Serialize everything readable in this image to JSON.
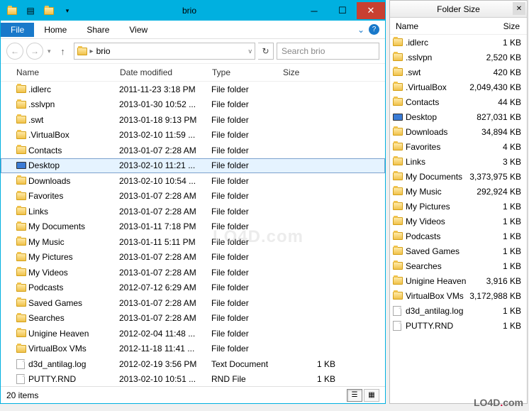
{
  "window": {
    "title": "brio",
    "tabs": {
      "file": "File",
      "home": "Home",
      "share": "Share",
      "view": "View"
    },
    "breadcrumb": "brio",
    "search_placeholder": "Search brio",
    "columns": {
      "name": "Name",
      "date": "Date modified",
      "type": "Type",
      "size": "Size"
    },
    "status": "20 items",
    "selected_index": 5
  },
  "files": [
    {
      "name": ".idlerc",
      "date": "2011-11-23 3:18 PM",
      "type": "File folder",
      "size": "",
      "icon": "folder"
    },
    {
      "name": ".sslvpn",
      "date": "2013-01-30 10:52 ...",
      "type": "File folder",
      "size": "",
      "icon": "folder"
    },
    {
      "name": ".swt",
      "date": "2013-01-18 9:13 PM",
      "type": "File folder",
      "size": "",
      "icon": "folder"
    },
    {
      "name": ".VirtualBox",
      "date": "2013-02-10 11:59 ...",
      "type": "File folder",
      "size": "",
      "icon": "folder"
    },
    {
      "name": "Contacts",
      "date": "2013-01-07 2:28 AM",
      "type": "File folder",
      "size": "",
      "icon": "folder"
    },
    {
      "name": "Desktop",
      "date": "2013-02-10 11:21 ...",
      "type": "File folder",
      "size": "",
      "icon": "monitor"
    },
    {
      "name": "Downloads",
      "date": "2013-02-10 10:54 ...",
      "type": "File folder",
      "size": "",
      "icon": "folder"
    },
    {
      "name": "Favorites",
      "date": "2013-01-07 2:28 AM",
      "type": "File folder",
      "size": "",
      "icon": "folder"
    },
    {
      "name": "Links",
      "date": "2013-01-07 2:28 AM",
      "type": "File folder",
      "size": "",
      "icon": "folder"
    },
    {
      "name": "My Documents",
      "date": "2013-01-11 7:18 PM",
      "type": "File folder",
      "size": "",
      "icon": "folder"
    },
    {
      "name": "My Music",
      "date": "2013-01-11 5:11 PM",
      "type": "File folder",
      "size": "",
      "icon": "folder"
    },
    {
      "name": "My Pictures",
      "date": "2013-01-07 2:28 AM",
      "type": "File folder",
      "size": "",
      "icon": "folder"
    },
    {
      "name": "My Videos",
      "date": "2013-01-07 2:28 AM",
      "type": "File folder",
      "size": "",
      "icon": "folder"
    },
    {
      "name": "Podcasts",
      "date": "2012-07-12 6:29 AM",
      "type": "File folder",
      "size": "",
      "icon": "folder"
    },
    {
      "name": "Saved Games",
      "date": "2013-01-07 2:28 AM",
      "type": "File folder",
      "size": "",
      "icon": "folder"
    },
    {
      "name": "Searches",
      "date": "2013-01-07 2:28 AM",
      "type": "File folder",
      "size": "",
      "icon": "folder"
    },
    {
      "name": "Unigine Heaven",
      "date": "2012-02-04 11:48 ...",
      "type": "File folder",
      "size": "",
      "icon": "folder"
    },
    {
      "name": "VirtualBox VMs",
      "date": "2012-11-18 11:41 ...",
      "type": "File folder",
      "size": "",
      "icon": "folder"
    },
    {
      "name": "d3d_antilag.log",
      "date": "2012-02-19 3:56 PM",
      "type": "Text Document",
      "size": "1 KB",
      "icon": "file"
    },
    {
      "name": "PUTTY.RND",
      "date": "2013-02-10 10:51 ...",
      "type": "RND File",
      "size": "1 KB",
      "icon": "file"
    }
  ],
  "panel": {
    "title": "Folder Size",
    "columns": {
      "name": "Name",
      "size": "Size"
    }
  },
  "panel_rows": [
    {
      "name": ".idlerc",
      "size": "1 KB",
      "icon": "folder"
    },
    {
      "name": ".sslvpn",
      "size": "2,520 KB",
      "icon": "folder"
    },
    {
      "name": ".swt",
      "size": "420 KB",
      "icon": "folder"
    },
    {
      "name": ".VirtualBox",
      "size": "2,049,430 KB",
      "icon": "folder"
    },
    {
      "name": "Contacts",
      "size": "44 KB",
      "icon": "folder"
    },
    {
      "name": "Desktop",
      "size": "827,031 KB",
      "icon": "monitor"
    },
    {
      "name": "Downloads",
      "size": "34,894 KB",
      "icon": "folder"
    },
    {
      "name": "Favorites",
      "size": "4 KB",
      "icon": "folder"
    },
    {
      "name": "Links",
      "size": "3 KB",
      "icon": "folder"
    },
    {
      "name": "My Documents",
      "size": "3,373,975 KB",
      "icon": "folder"
    },
    {
      "name": "My Music",
      "size": "292,924 KB",
      "icon": "folder"
    },
    {
      "name": "My Pictures",
      "size": "1 KB",
      "icon": "folder"
    },
    {
      "name": "My Videos",
      "size": "1 KB",
      "icon": "folder"
    },
    {
      "name": "Podcasts",
      "size": "1 KB",
      "icon": "folder"
    },
    {
      "name": "Saved Games",
      "size": "1 KB",
      "icon": "folder"
    },
    {
      "name": "Searches",
      "size": "1 KB",
      "icon": "folder"
    },
    {
      "name": "Unigine Heaven",
      "size": "3,916 KB",
      "icon": "folder"
    },
    {
      "name": "VirtualBox VMs",
      "size": "3,172,988 KB",
      "icon": "folder"
    },
    {
      "name": "d3d_antilag.log",
      "size": "1 KB",
      "icon": "file"
    },
    {
      "name": "PUTTY.RND",
      "size": "1 KB",
      "icon": "file"
    }
  ],
  "watermark": "LO4D.com"
}
